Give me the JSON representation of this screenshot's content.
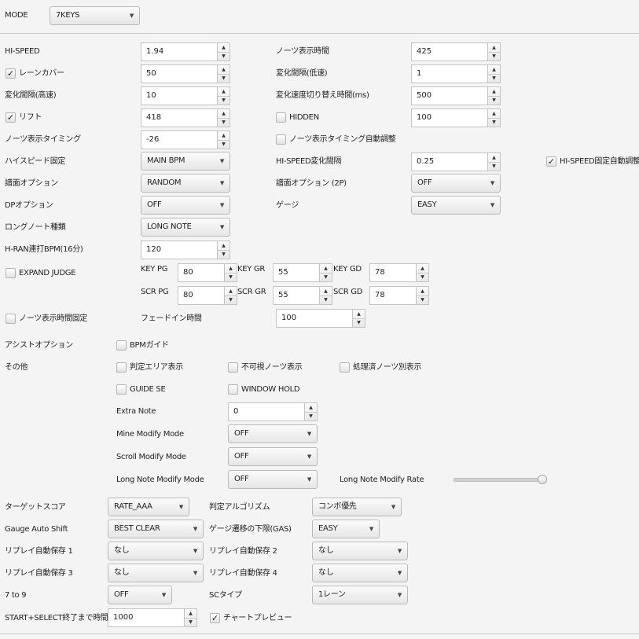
{
  "mode": {
    "label": "MODE",
    "value": "7KEYS"
  },
  "left": {
    "hispeed": {
      "label": "HI-SPEED",
      "value": "1.94"
    },
    "lanecover": {
      "label": "レーンカバー",
      "value": "50",
      "checked": true
    },
    "interval_fast": {
      "label": "変化間隔(高速)",
      "value": "10"
    },
    "lift": {
      "label": "リフト",
      "value": "418",
      "checked": true
    },
    "note_timing": {
      "label": "ノーツ表示タイミング",
      "value": "-26"
    },
    "hispeed_fix": {
      "label": "ハイスピード固定",
      "value": "MAIN BPM"
    },
    "score_option": {
      "label": "譜面オプション",
      "value": "RANDOM"
    },
    "dp_option": {
      "label": "DPオプション",
      "value": "OFF"
    },
    "ln_type": {
      "label": "ロングノート種類",
      "value": "LONG NOTE"
    },
    "hran_bpm": {
      "label": "H-RAN連打BPM(16分)",
      "value": "120"
    }
  },
  "right": {
    "note_duration": {
      "label": "ノーツ表示時間",
      "value": "425"
    },
    "interval_slow": {
      "label": "変化間隔(低速)",
      "value": "1"
    },
    "switch_time": {
      "label": "変化速度切り替え時間(ms)",
      "value": "500"
    },
    "hidden": {
      "label": "HIDDEN",
      "value": "100",
      "checked": false
    },
    "auto_timing": {
      "label": "ノーツ表示タイミング自動調整",
      "checked": false
    },
    "hispeed_interval": {
      "label": "HI-SPEED変化間隔",
      "value": "0.25"
    },
    "hispeed_auto": {
      "label": "HI-SPEED固定自動調整",
      "checked": true
    },
    "score_option_2p": {
      "label": "譜面オプション (2P)",
      "value": "OFF"
    },
    "gauge": {
      "label": "ゲージ",
      "value": "EASY"
    }
  },
  "judge": {
    "expand": {
      "label": "EXPAND JUDGE",
      "checked": false
    },
    "key_pg": {
      "label": "KEY PG",
      "value": "80"
    },
    "key_gr": {
      "label": "KEY GR",
      "value": "55"
    },
    "key_gd": {
      "label": "KEY GD",
      "value": "78"
    },
    "scr_pg": {
      "label": "SCR PG",
      "value": "80"
    },
    "scr_gr": {
      "label": "SCR GR",
      "value": "55"
    },
    "scr_gd": {
      "label": "SCR GD",
      "value": "78"
    }
  },
  "fixed_duration": {
    "label": "ノーツ表示時間固定",
    "checked": false
  },
  "fadein": {
    "label": "フェードイン時間",
    "value": "100"
  },
  "assist": {
    "label": "アシストオプション",
    "bpm_guide": {
      "label": "BPMガイド",
      "checked": false
    }
  },
  "other": {
    "label": "その他",
    "judge_area": {
      "label": "判定エリア表示",
      "checked": false
    },
    "invisible": {
      "label": "不可視ノーツ表示",
      "checked": false
    },
    "processed": {
      "label": "処理済ノーツ別表示",
      "checked": false
    },
    "guide_se": {
      "label": "GUIDE SE",
      "checked": false
    },
    "window_hold": {
      "label": "WINDOW HOLD",
      "checked": false
    },
    "extra_note": {
      "label": "Extra Note",
      "value": "0"
    },
    "mine_mode": {
      "label": "Mine Modify Mode",
      "value": "OFF"
    },
    "scroll_mode": {
      "label": "Scroll Modify Mode",
      "value": "OFF"
    },
    "ln_mode": {
      "label": "Long Note Modify Mode",
      "value": "OFF"
    },
    "ln_rate": {
      "label": "Long Note Modify Rate",
      "level": 1.0
    }
  },
  "bottom": {
    "target": {
      "label": "ターゲットスコア",
      "value": "RATE_AAA"
    },
    "judge_algo": {
      "label": "判定アルゴリズム",
      "value": "コンボ優先"
    },
    "gauge_shift": {
      "label": "Gauge Auto Shift",
      "value": "BEST CLEAR"
    },
    "gauge_min": {
      "label": "ゲージ遷移の下限(GAS)",
      "value": "EASY"
    },
    "replay1": {
      "label": "リプレイ自動保存 1",
      "value": "なし"
    },
    "replay2": {
      "label": "リプレイ自動保存 2",
      "value": "なし"
    },
    "replay3": {
      "label": "リプレイ自動保存 3",
      "value": "なし"
    },
    "replay4": {
      "label": "リプレイ自動保存 4",
      "value": "なし"
    },
    "seven_to_nine": {
      "label": "7 to 9",
      "value": "OFF"
    },
    "sc_type": {
      "label": "SCタイプ",
      "value": "1レーン"
    },
    "start_select": {
      "label": "START+SELECT終了まで時間",
      "value": "1000"
    },
    "chart_preview": {
      "label": "チャートプレビュー",
      "checked": true
    }
  },
  "glyphs": {
    "dropdown": "▼",
    "up": "▲",
    "down": "▼",
    "check": "✓"
  }
}
